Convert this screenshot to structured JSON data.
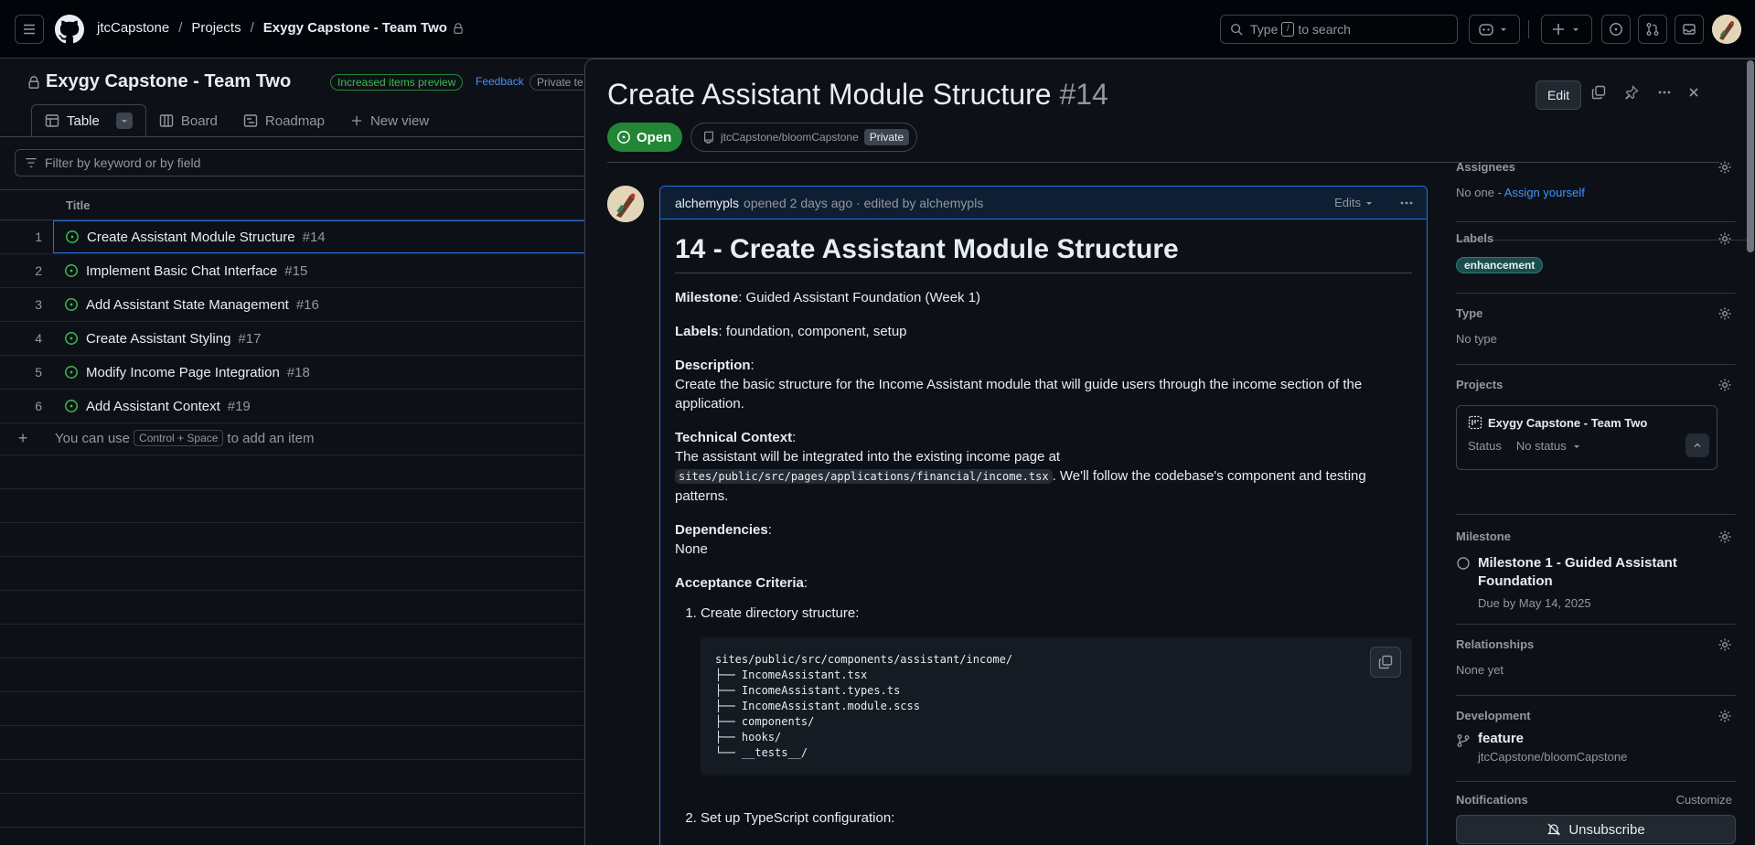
{
  "header": {
    "owner": "jtcCapstone",
    "projects_link": "Projects",
    "project_name": "Exygy Capstone - Team Two",
    "search_prefix": "Type",
    "search_key": "/",
    "search_suffix": "to search"
  },
  "project": {
    "title": "Exygy Capstone - Team Two",
    "preview_badge": "Increased items preview",
    "feedback_link": "Feedback",
    "private_badge": "Private te",
    "views": [
      {
        "label": "Table",
        "icon": "table-icon"
      },
      {
        "label": "Board",
        "icon": "board-icon"
      },
      {
        "label": "Roadmap",
        "icon": "roadmap-icon"
      },
      {
        "label": "New view",
        "icon": "plus-icon"
      }
    ],
    "filter_placeholder": "Filter by keyword or by field",
    "column_title": "Title",
    "rows": [
      {
        "num": "1",
        "title": "Create Assistant Module Structure",
        "issue": "#14"
      },
      {
        "num": "2",
        "title": "Implement Basic Chat Interface",
        "issue": "#15"
      },
      {
        "num": "3",
        "title": "Add Assistant State Management",
        "issue": "#16"
      },
      {
        "num": "4",
        "title": "Create Assistant Styling",
        "issue": "#17"
      },
      {
        "num": "5",
        "title": "Modify Income Page Integration",
        "issue": "#18"
      },
      {
        "num": "6",
        "title": "Add Assistant Context",
        "issue": "#19"
      }
    ],
    "add_item_prefix": "You can use",
    "add_item_key": "Control + Space",
    "add_item_suffix": "to add an item"
  },
  "issue": {
    "title": "Create Assistant Module Structure",
    "number": "#14",
    "edit_label": "Edit",
    "state": "Open",
    "repo": "jtcCapstone/bloomCapstone",
    "repo_visibility": "Private",
    "comment": {
      "author": "alchemypls",
      "meta": "opened 2 days ago · edited by alchemypls",
      "edits_label": "Edits",
      "heading": "14 - Create Assistant Module Structure",
      "milestone_label": "Milestone",
      "milestone_value": ": Guided Assistant Foundation (Week 1)",
      "labels_label": "Labels",
      "labels_value": ": foundation, component, setup",
      "description_label": "Description",
      "description_text": "Create the basic structure for the Income Assistant module that will guide users through the income section of the application.",
      "tech_label": "Technical Context",
      "tech_text_1": "The assistant will be integrated into the existing income page at",
      "tech_code": "sites/public/src/pages/applications/financial/income.tsx",
      "tech_text_2": ". We'll follow the codebase's component and testing patterns.",
      "deps_label": "Dependencies",
      "deps_text": "None",
      "criteria_label": "Acceptance Criteria",
      "step1": "Create directory structure:",
      "code_block": "sites/public/src/components/assistant/income/\n├── IncomeAssistant.tsx\n├── IncomeAssistant.types.ts\n├── IncomeAssistant.module.scss\n├── components/\n├── hooks/\n└── __tests__/",
      "step2": "Set up TypeScript configuration:"
    },
    "sidebar": {
      "assignees_label": "Assignees",
      "assignees_value": "No one - ",
      "assign_yourself": "Assign yourself",
      "labels_label": "Labels",
      "label_pill": "enhancement",
      "type_label": "Type",
      "type_value": "No type",
      "projects_label": "Projects",
      "project_name": "Exygy Capstone - Team Two",
      "status_label": "Status",
      "status_value": "No status",
      "milestone_label": "Milestone",
      "milestone_name": "Milestone 1 - Guided Assistant Foundation",
      "milestone_due": "Due by May 14, 2025",
      "relationships_label": "Relationships",
      "relationships_value": "None yet",
      "development_label": "Development",
      "branch_name": "feature",
      "branch_repo": "jtcCapstone/bloomCapstone",
      "notifications_label": "Notifications",
      "customize_link": "Customize",
      "unsubscribe_label": "Unsubscribe"
    }
  },
  "colors": {
    "bg": "#0d1117",
    "accent": "#1f6feb",
    "open_green": "#238636",
    "label_teal": "#1b4d4d"
  }
}
